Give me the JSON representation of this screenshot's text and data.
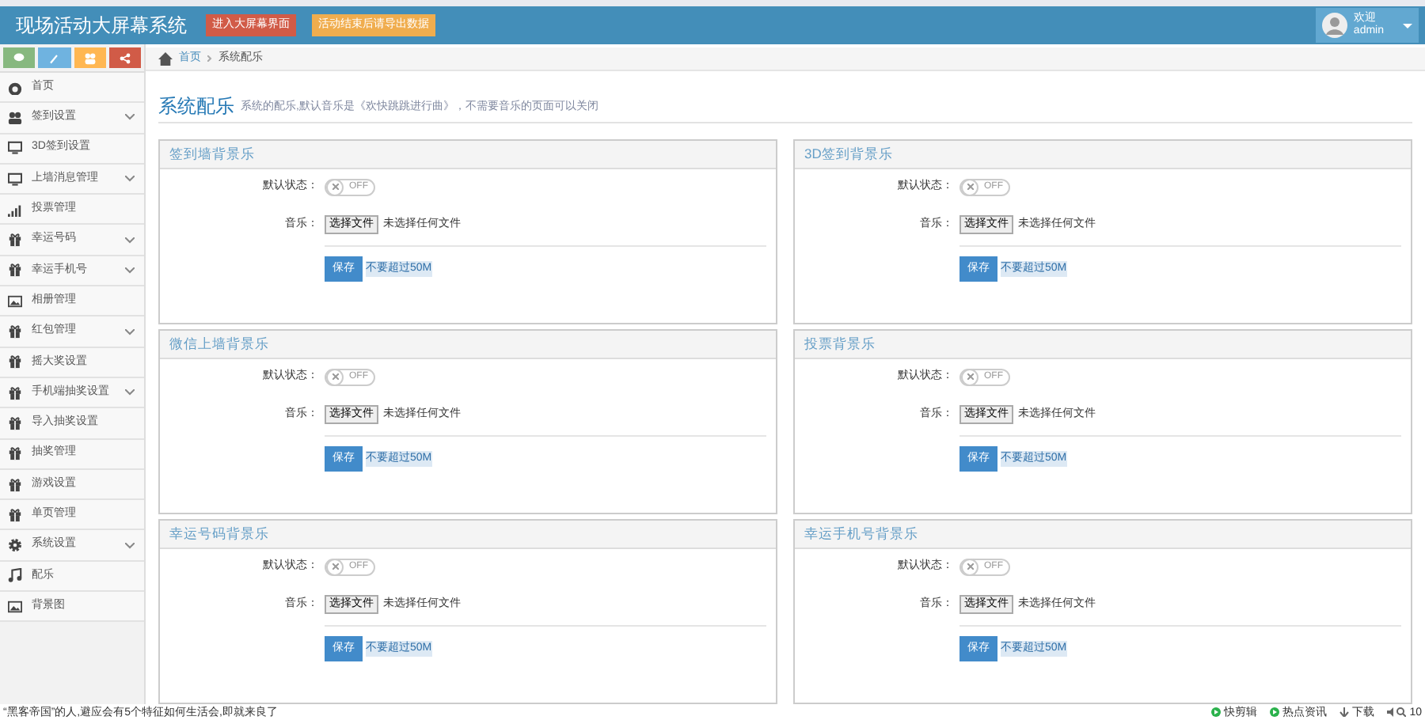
{
  "header": {
    "title": "现场活动大屏幕系统",
    "buttons": [
      {
        "label": "进入大屏幕界面",
        "kind": "danger"
      },
      {
        "label": "活动结束后请导出数据",
        "kind": "warning"
      }
    ],
    "user": {
      "greeting": "欢迎",
      "name": "admin"
    }
  },
  "sidebar": {
    "items": [
      {
        "label": "首页",
        "expandable": false
      },
      {
        "label": "签到设置",
        "expandable": true
      },
      {
        "label": "3D签到设置",
        "expandable": false
      },
      {
        "label": "上墙消息管理",
        "expandable": true
      },
      {
        "label": "投票管理",
        "expandable": false
      },
      {
        "label": "幸运号码",
        "expandable": true
      },
      {
        "label": "幸运手机号",
        "expandable": true
      },
      {
        "label": "相册管理",
        "expandable": false
      },
      {
        "label": "红包管理",
        "expandable": true
      },
      {
        "label": "摇大奖设置",
        "expandable": false
      },
      {
        "label": "手机端抽奖设置",
        "expandable": true
      },
      {
        "label": "导入抽奖设置",
        "expandable": false
      },
      {
        "label": "抽奖管理",
        "expandable": false
      },
      {
        "label": "游戏设置",
        "expandable": false
      },
      {
        "label": "单页管理",
        "expandable": false
      },
      {
        "label": "系统设置",
        "expandable": true
      },
      {
        "label": "配乐",
        "expandable": false
      },
      {
        "label": "背景图",
        "expandable": false
      }
    ]
  },
  "breadcrumb": [
    "首页",
    "系统配乐"
  ],
  "page": {
    "title": "系统配乐",
    "description": "系统的配乐,默认音乐是《欢快跳跳进行曲》，不需要音乐的页面可以关闭"
  },
  "panels": [
    {
      "title": "签到墙背景乐",
      "status_label": "默认状态：",
      "on": false,
      "toggle_text": "OFF",
      "music_label": "音乐：",
      "file_button": "选择文件",
      "file_status": "未选择任何文件",
      "save": "保存",
      "hint": "不要超过50M"
    },
    {
      "title": "3D签到背景乐",
      "status_label": "默认状态：",
      "on": false,
      "toggle_text": "OFF",
      "music_label": "音乐：",
      "file_button": "选择文件",
      "file_status": "未选择任何文件",
      "save": "保存",
      "hint": "不要超过50M"
    },
    {
      "title": "微信上墙背景乐",
      "status_label": "默认状态：",
      "on": false,
      "toggle_text": "OFF",
      "music_label": "音乐：",
      "file_button": "选择文件",
      "file_status": "未选择任何文件",
      "save": "保存",
      "hint": "不要超过50M"
    },
    {
      "title": "投票背景乐",
      "status_label": "默认状态：",
      "on": false,
      "toggle_text": "OFF",
      "music_label": "音乐：",
      "file_button": "选择文件",
      "file_status": "未选择任何文件",
      "save": "保存",
      "hint": "不要超过50M"
    },
    {
      "title": "幸运号码背景乐",
      "status_label": "默认状态：",
      "on": false,
      "toggle_text": "OFF",
      "music_label": "音乐：",
      "file_button": "选择文件",
      "file_status": "未选择任何文件",
      "save": "保存",
      "hint": "不要超过50M"
    },
    {
      "title": "幸运手机号背景乐",
      "status_label": "默认状态：",
      "on": false,
      "toggle_text": "OFF",
      "music_label": "音乐：",
      "file_button": "选择文件",
      "file_status": "未选择任何文件",
      "save": "保存",
      "hint": "不要超过50M"
    }
  ],
  "status_bar": {
    "news": "“黑客帝国”的人,避应会有5个特征如何生活会,即就来良了",
    "items": [
      "快剪辑",
      "热点资讯",
      "下载"
    ],
    "zoom": "10"
  }
}
